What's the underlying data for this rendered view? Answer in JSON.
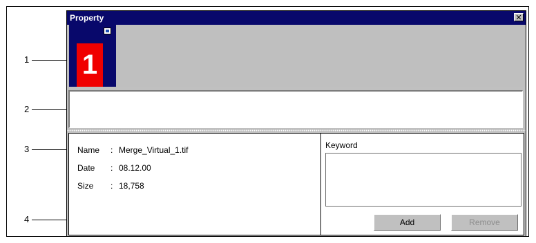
{
  "window": {
    "title": "Property",
    "close_glyph": "✕"
  },
  "thumbnail": {
    "label": "1",
    "badge_icon": "edit-badge-icon",
    "image_color": "#f00000"
  },
  "info": {
    "rows": [
      {
        "label": "Name",
        "sep": ":",
        "value": "Merge_Virtual_1.tif"
      },
      {
        "label": "Date",
        "sep": ":",
        "value": "08.12.00"
      },
      {
        "label": "Size",
        "sep": ":",
        "value": "18,758"
      }
    ]
  },
  "keyword": {
    "label": "Keyword",
    "value": ""
  },
  "buttons": {
    "add": "Add",
    "remove": "Remove"
  },
  "callouts": [
    "1",
    "2",
    "3",
    "4"
  ],
  "colors": {
    "title_bar": "#08086b",
    "panel_gray": "#c0c0c0"
  }
}
